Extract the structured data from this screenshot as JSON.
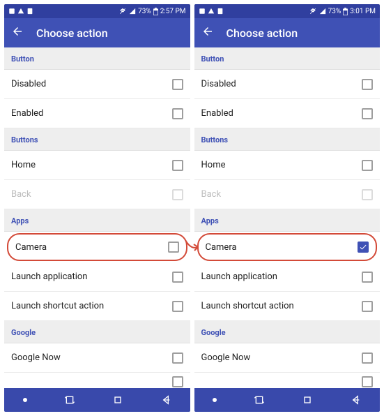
{
  "screens": [
    {
      "statusbar": {
        "battery": "73%",
        "time": "2:57 PM"
      },
      "appbar": {
        "title": "Choose action"
      },
      "sections": [
        {
          "header": "Button",
          "rows": [
            {
              "label": "Disabled",
              "checked": false,
              "disabled": false
            },
            {
              "label": "Enabled",
              "checked": false,
              "disabled": false
            }
          ]
        },
        {
          "header": "Buttons",
          "rows": [
            {
              "label": "Home",
              "checked": false,
              "disabled": false
            },
            {
              "label": "Back",
              "checked": false,
              "disabled": true
            }
          ]
        },
        {
          "header": "Apps",
          "rows": [
            {
              "label": "Camera",
              "checked": false,
              "disabled": false,
              "highlighted": true
            },
            {
              "label": "Launch application",
              "checked": false,
              "disabled": false
            },
            {
              "label": "Launch shortcut action",
              "checked": false,
              "disabled": false
            }
          ]
        },
        {
          "header": "Google",
          "rows": [
            {
              "label": "Google Now",
              "checked": false,
              "disabled": false
            },
            {
              "label": "",
              "checked": false,
              "disabled": false,
              "partial": true
            }
          ]
        }
      ]
    },
    {
      "statusbar": {
        "battery": "73%",
        "time": "3:01 PM"
      },
      "appbar": {
        "title": "Choose action"
      },
      "sections": [
        {
          "header": "Button",
          "rows": [
            {
              "label": "Disabled",
              "checked": false,
              "disabled": false
            },
            {
              "label": "Enabled",
              "checked": false,
              "disabled": false
            }
          ]
        },
        {
          "header": "Buttons",
          "rows": [
            {
              "label": "Home",
              "checked": false,
              "disabled": false
            },
            {
              "label": "Back",
              "checked": false,
              "disabled": true
            }
          ]
        },
        {
          "header": "Apps",
          "rows": [
            {
              "label": "Camera",
              "checked": true,
              "disabled": false,
              "highlighted": true
            },
            {
              "label": "Launch application",
              "checked": false,
              "disabled": false
            },
            {
              "label": "Launch shortcut action",
              "checked": false,
              "disabled": false
            }
          ]
        },
        {
          "header": "Google",
          "rows": [
            {
              "label": "Google Now",
              "checked": false,
              "disabled": false
            },
            {
              "label": "",
              "checked": false,
              "disabled": false,
              "partial": true
            }
          ]
        }
      ]
    }
  ]
}
